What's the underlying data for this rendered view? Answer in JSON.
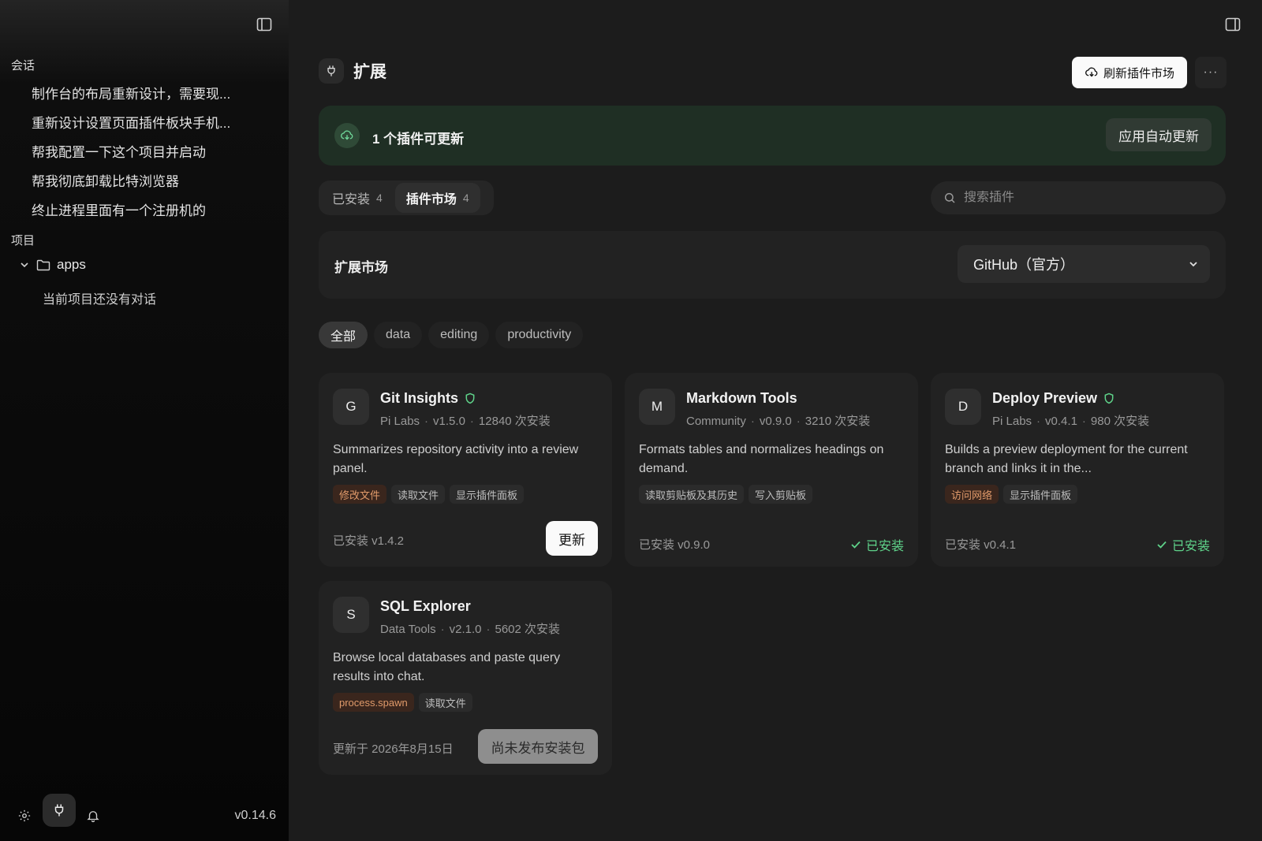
{
  "sidebar": {
    "conversations_heading": "会话",
    "conversations": [
      "制作台的布局重新设计，需要现...",
      "重新设计设置页面插件板块手机...",
      "帮我配置一下这个项目并启动",
      "帮我彻底卸载比特浏览器",
      "终止进程里面有一个注册机的"
    ],
    "projects_heading": "项目",
    "folder_name": "apps",
    "empty_text": "当前项目还没有对话",
    "version": "v0.14.6"
  },
  "header": {
    "title": "扩展",
    "refresh_label": "刷新插件市场",
    "more_label": "···"
  },
  "banner": {
    "text": "1 个插件可更新",
    "button": "应用自动更新"
  },
  "tabs": [
    {
      "label": "已安装",
      "count": "4"
    },
    {
      "label": "插件市场",
      "count": "4"
    }
  ],
  "search": {
    "placeholder": "搜索插件"
  },
  "market": {
    "title": "扩展市场",
    "selected_source": "GitHub（官方）"
  },
  "filters": [
    "全部",
    "data",
    "editing",
    "productivity"
  ],
  "plugins": [
    {
      "initial": "G",
      "name": "Git Insights",
      "author": "Pi Labs",
      "version": "v1.5.0",
      "installs": "12840 次安装",
      "description": "Summarizes repository activity into a review panel.",
      "permissions": [
        "修改文件",
        "读取文件",
        "显示插件面板"
      ],
      "footer": "已安装 v1.4.2",
      "action": "更新"
    },
    {
      "initial": "M",
      "name": "Markdown Tools",
      "author": "Community",
      "version": "v0.9.0",
      "installs": "3210 次安装",
      "description": "Formats tables and normalizes headings on demand.",
      "permissions": [
        "读取剪贴板及其历史",
        "写入剪贴板"
      ],
      "footer": "已安装 v0.9.0",
      "action": "已安装"
    },
    {
      "initial": "D",
      "name": "Deploy Preview",
      "author": "Pi Labs",
      "version": "v0.4.1",
      "installs": "980 次安装",
      "description": "Builds a preview deployment for the current branch and links it in the...",
      "permissions": [
        "访问网络",
        "显示插件面板"
      ],
      "footer": "已安装 v0.4.1",
      "action": "已安装"
    },
    {
      "initial": "S",
      "name": "SQL Explorer",
      "author": "Data Tools",
      "version": "v2.1.0",
      "installs": "5602 次安装",
      "description": "Browse local databases and paste query results into chat.",
      "permissions": [
        "process.spawn",
        "读取文件"
      ],
      "footer": "更新于 2026年8月15日",
      "action": "尚未发布安装包"
    }
  ],
  "colors": {
    "background": "#1c1c1c",
    "sidebar": "#060606",
    "card": "#222222",
    "banner": "#1f2f24",
    "success": "#5fd38a",
    "warning": "#e09a6a",
    "verified": "#5fd38a"
  }
}
